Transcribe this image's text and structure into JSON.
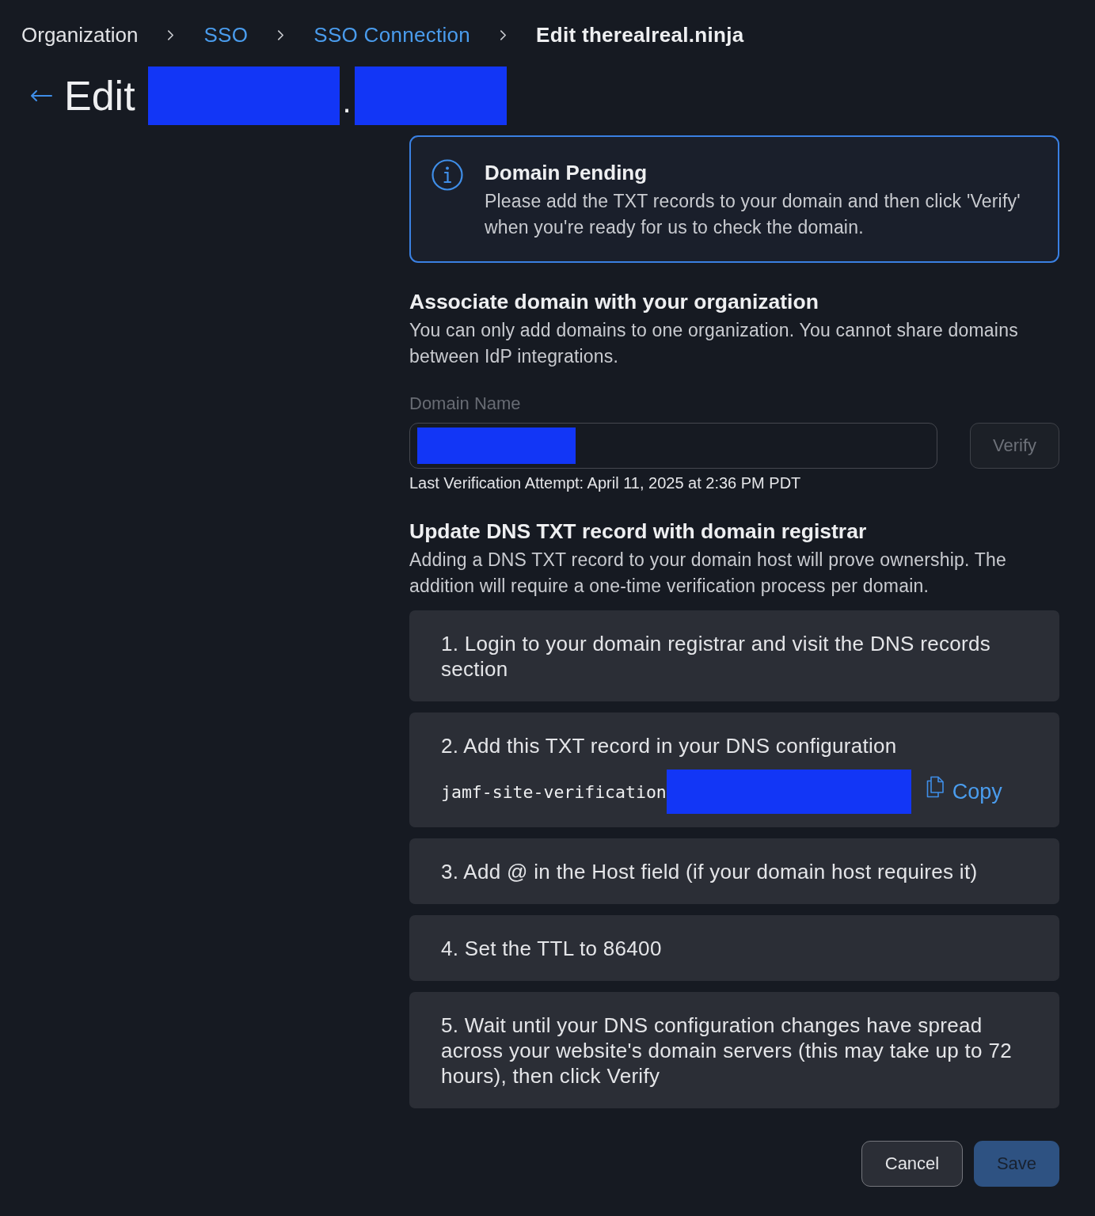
{
  "breadcrumb": [
    {
      "label": "Organization",
      "kind": "plain"
    },
    {
      "label": "SSO",
      "kind": "link"
    },
    {
      "label": "SSO Connection",
      "kind": "link"
    },
    {
      "label": "Edit therealreal.ninja",
      "kind": "current"
    }
  ],
  "page_title": {
    "label": "Edit",
    "parts": [
      {
        "kind": "redacted"
      },
      {
        "kind": "text",
        "text": "."
      },
      {
        "kind": "redacted"
      }
    ]
  },
  "alert": {
    "kind": "info",
    "title": "Domain Pending",
    "message": "Please add the TXT records to your domain and then click 'Verify' when you're ready for us to check the domain."
  },
  "associate_section": {
    "heading": "Associate domain with your organization",
    "description": "You can only add domains to one organization. You cannot share domains between IdP integrations."
  },
  "domain_field": {
    "label": "Domain Name",
    "value_redacted": true,
    "verify_button": {
      "label": "Verify",
      "disabled": true
    },
    "last_attempt": "Last Verification Attempt: April 11, 2025 at 2:36 PM PDT"
  },
  "dns_section": {
    "heading": "Update DNS TXT record with domain registrar",
    "description": "Adding a DNS TXT record to your domain host will prove ownership. The addition will require a one-time verification process per domain."
  },
  "steps": [
    {
      "kind": "text",
      "text": "1. Login to your domain registrar and visit the DNS records section"
    },
    {
      "kind": "record",
      "text": "2. Add this TXT record in your DNS configuration",
      "record_prefix": "jamf-site-verification",
      "value_redacted": true,
      "copy_label": "Copy"
    },
    {
      "kind": "text",
      "text": "3. Add @ in the Host field (if your domain host requires it)"
    },
    {
      "kind": "text",
      "text": "4. Set the TTL to 86400"
    },
    {
      "kind": "text",
      "text": "5. Wait until your DNS configuration changes have spread across your website's domain servers (this may take up to 72 hours), then click Verify"
    }
  ],
  "actions": [
    {
      "label": "Cancel",
      "kind": "secondary",
      "disabled": false
    },
    {
      "label": "Save",
      "kind": "primary",
      "disabled": true
    }
  ]
}
